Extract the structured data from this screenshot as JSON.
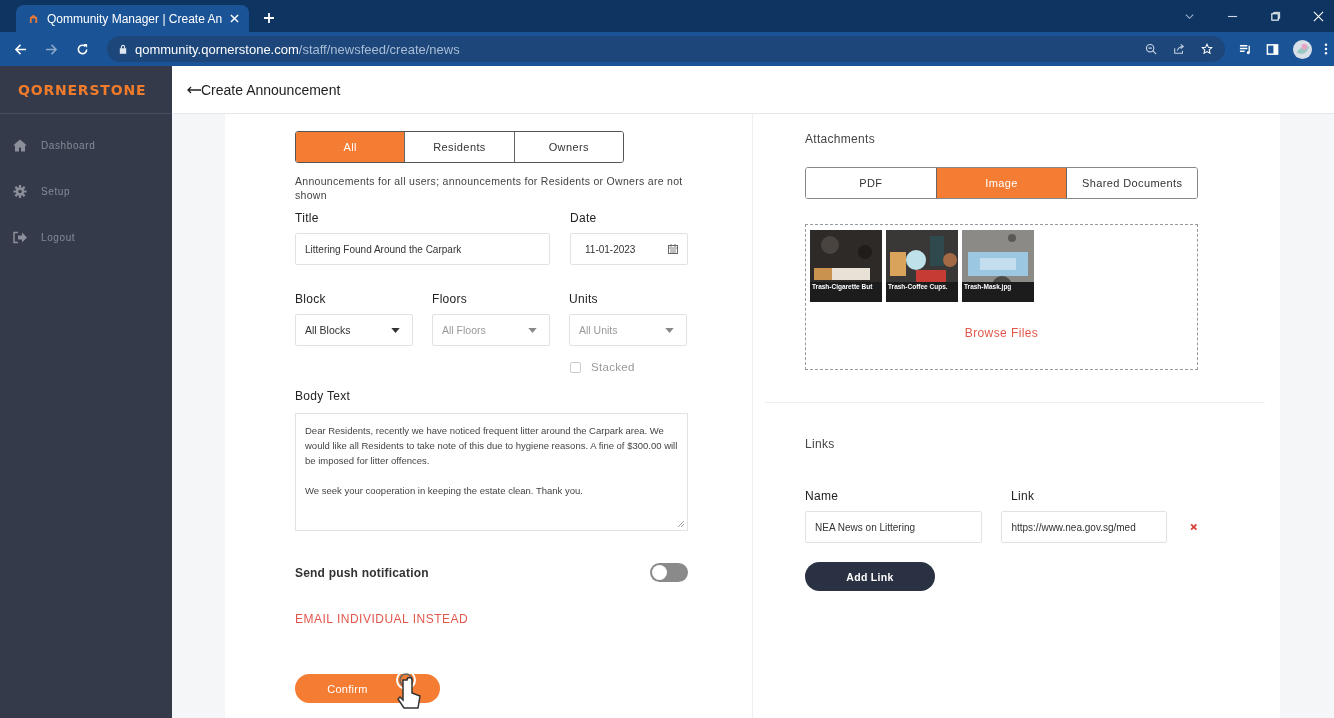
{
  "browser": {
    "tab_title": "Qommunity Manager | Create An",
    "url_host": "qommunity.qornerstone.com",
    "url_path": "/staff/newsfeed/create/news"
  },
  "sidebar": {
    "logo": "QORNERSTONE",
    "items": [
      {
        "label": "Dashboard"
      },
      {
        "label": "Setup"
      },
      {
        "label": "Logout"
      }
    ]
  },
  "header": {
    "title": "Create Announcement"
  },
  "audience_tabs": [
    {
      "label": "All",
      "selected": true
    },
    {
      "label": "Residents",
      "selected": false
    },
    {
      "label": "Owners",
      "selected": false
    }
  ],
  "audience_note": "Announcements for all users; announcements for Residents or Owners are not shown",
  "title_field": {
    "label": "Title",
    "value": "Littering Found Around the Carpark"
  },
  "date_field": {
    "label": "Date",
    "value": "11-01-2023"
  },
  "selects": [
    {
      "label": "Block",
      "value": "All Blocks",
      "disabled": false
    },
    {
      "label": "Floors",
      "value": "All Floors",
      "disabled": true
    },
    {
      "label": "Units",
      "value": "All Units",
      "disabled": true
    }
  ],
  "stacked": {
    "label": "Stacked",
    "checked": false,
    "disabled": true
  },
  "body_text": {
    "label": "Body Text",
    "paragraphs": [
      "Dear Residents, recently we have noticed frequent litter around the Carpark area. We would like all Residents to take note of this due to hygiene reasons. A fine of $300.00 will be imposed for litter offences.",
      "We seek your cooperation in keeping the estate clean. Thank you."
    ]
  },
  "push_notification": {
    "label": "Send push notification",
    "on": false
  },
  "email_link": "EMAIL INDIVIDUAL INSTEAD",
  "confirm_button": "Confirm",
  "attachments": {
    "title": "Attachments",
    "tabs": [
      {
        "label": "PDF",
        "selected": false
      },
      {
        "label": "Image",
        "selected": true
      },
      {
        "label": "Shared Documents",
        "selected": false
      }
    ],
    "images": [
      {
        "caption": "Trash-Cigarette But"
      },
      {
        "caption": "Trash-Coffee Cups."
      },
      {
        "caption": "Trash-Mask.jpg"
      }
    ],
    "browse": "Browse Files"
  },
  "links": {
    "title": "Links",
    "name_label": "Name",
    "link_label": "Link",
    "rows": [
      {
        "name": "NEA News on Littering",
        "url": "https://www.nea.gov.sg/med"
      }
    ],
    "add_button": "Add Link"
  }
}
